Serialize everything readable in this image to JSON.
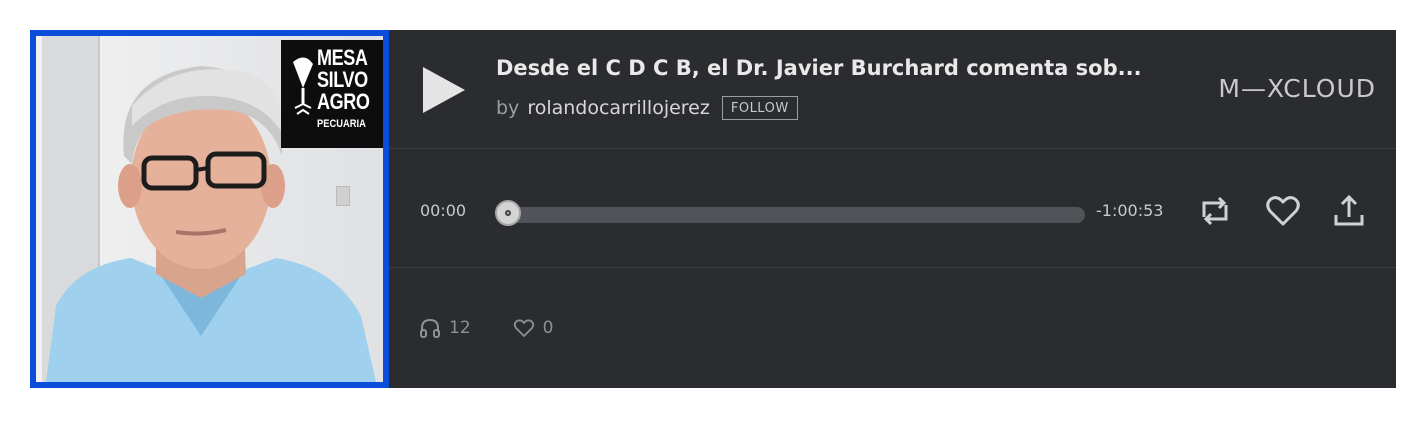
{
  "artwork": {
    "logo_lines": [
      "MESA",
      "SILVO",
      "AGRO",
      "PECUARIA"
    ]
  },
  "track": {
    "title": "Desde el C D C B, el Dr. Javier Burchard comenta sob...",
    "by_label": "by",
    "user": "rolandocarrillojerez",
    "follow_label": "FOLLOW"
  },
  "brand": {
    "name": "M—XCLOUD"
  },
  "player": {
    "current_time": "00:00",
    "remaining_time": "-1:00:53",
    "progress": 0
  },
  "stats": {
    "plays": "12",
    "favorites": "0"
  },
  "colors": {
    "background": "#2a2c2f",
    "artwork_border": "#0a4dd8",
    "text": "#e9e9e9",
    "muted": "#8d9095"
  },
  "icons": [
    "play-icon",
    "repost-icon",
    "heart-icon",
    "share-icon",
    "headphones-icon",
    "heart-outline-icon"
  ]
}
